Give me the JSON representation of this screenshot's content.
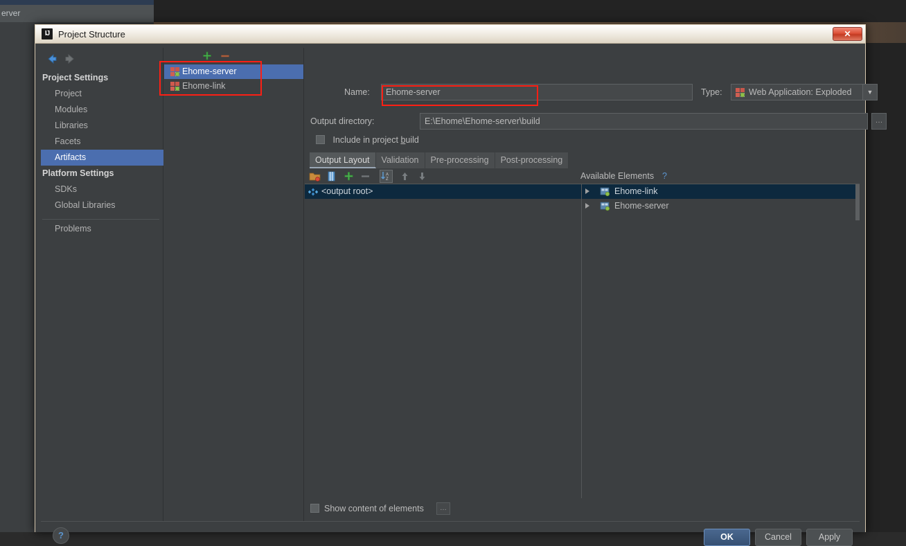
{
  "background": {
    "ide_tab_label": "erver"
  },
  "dialog": {
    "title": "Project Structure",
    "app_icon": "intellij-idea-icon",
    "close_label": "✕"
  },
  "nav": {
    "back_icon": "arrow-left-icon",
    "forward_icon": "arrow-right-icon"
  },
  "sidebar": {
    "groups": [
      {
        "label": "Project Settings",
        "items": [
          {
            "label": "Project",
            "selected": false
          },
          {
            "label": "Modules",
            "selected": false
          },
          {
            "label": "Libraries",
            "selected": false
          },
          {
            "label": "Facets",
            "selected": false
          },
          {
            "label": "Artifacts",
            "selected": true
          }
        ]
      },
      {
        "label": "Platform Settings",
        "items": [
          {
            "label": "SDKs",
            "selected": false
          },
          {
            "label": "Global Libraries",
            "selected": false
          }
        ]
      }
    ],
    "problems_label": "Problems"
  },
  "artifacts_panel": {
    "add_icon": "plus-icon",
    "remove_icon": "minus-icon",
    "items": [
      {
        "label": "Ehome-server",
        "icon": "artifact-icon",
        "selected": true
      },
      {
        "label": "Ehome-link",
        "icon": "artifact-icon",
        "selected": false
      }
    ]
  },
  "detail": {
    "name_label": "Name:",
    "name_value": "Ehome-server",
    "type_label": "Type:",
    "type_value": "Web Application: Exploded",
    "type_icon": "artifact-icon",
    "type_arrow": "▼",
    "output_dir_label": "Output directory:",
    "output_dir_value": "E:\\Ehome\\Ehome-server\\build",
    "browse_label": "…",
    "include_in_build_label_pre": "Include in project ",
    "include_in_build_label_accel": "b",
    "include_in_build_label_post": "uild",
    "include_in_build_checked": false,
    "tabs": [
      {
        "label": "Output Layout",
        "selected": true
      },
      {
        "label": "Validation",
        "selected": false
      },
      {
        "label": "Pre-processing",
        "selected": false
      },
      {
        "label": "Post-processing",
        "selected": false
      }
    ],
    "toolbar": {
      "folder_icon": "add-directory-icon",
      "jar_icon": "add-archive-icon",
      "plus_icon": "add-copy-icon",
      "minus_icon": "remove-icon",
      "sort_icon": "sort-alphabetically-icon",
      "up_icon": "move-up-icon",
      "down_icon": "move-down-icon"
    },
    "available_elements_label": "Available Elements",
    "available_elements_help": "?",
    "output_tree": [
      {
        "label": "<output root>",
        "icon": "output-root-icon",
        "selected": true
      }
    ],
    "available_elements": [
      {
        "label": "Ehome-link",
        "icon": "module-icon",
        "selected": true,
        "twisty": "chevron-right-icon"
      },
      {
        "label": "Ehome-server",
        "icon": "module-icon",
        "selected": false,
        "twisty": "chevron-right-icon"
      }
    ],
    "show_content_label": "Show content of elements",
    "show_content_checked": false,
    "show_content_more": "…"
  },
  "footer": {
    "help_label": "?",
    "ok_label": "OK",
    "cancel_label": "Cancel",
    "apply_label": "Apply"
  },
  "colors": {
    "accent_selection": "#4b6eaf",
    "tree_selection": "#0d293e",
    "annotation_red": "#fd1f14",
    "panel_bg": "#3c3f41",
    "link_blue": "#5b95cf"
  }
}
